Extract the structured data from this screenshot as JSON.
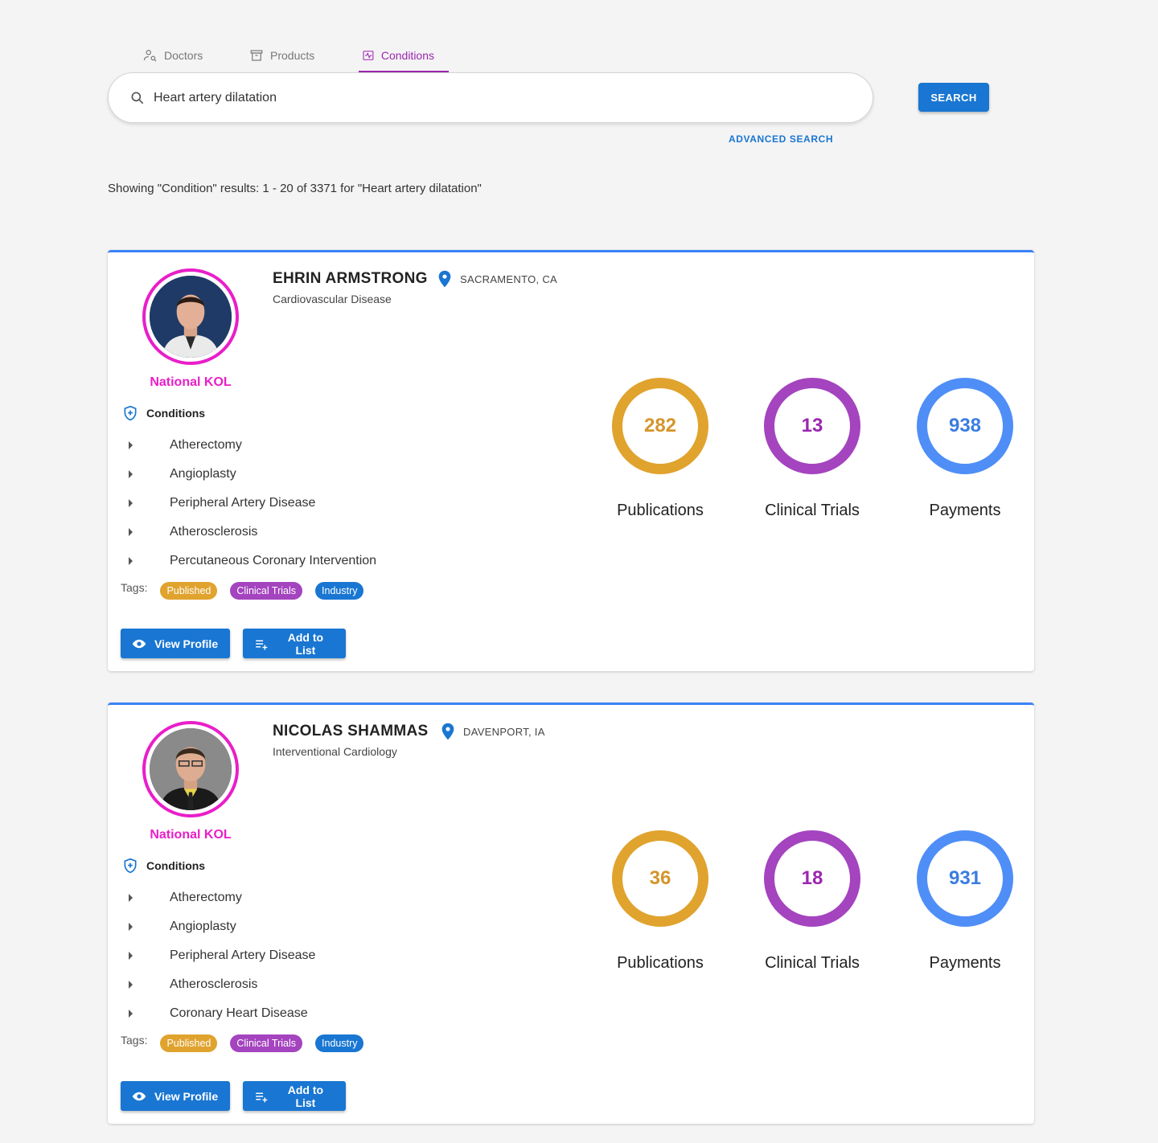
{
  "tabs": [
    {
      "label": "Doctors",
      "icon": "doctor-search-icon",
      "active": false
    },
    {
      "label": "Products",
      "icon": "archive-box-icon",
      "active": false
    },
    {
      "label": "Conditions",
      "icon": "condition-chart-icon",
      "active": true
    }
  ],
  "search": {
    "value": "Heart artery dilatation",
    "button_label": "SEARCH",
    "advanced_label": "ADVANCED SEARCH"
  },
  "results_summary": "Showing \"Condition\" results: 1 - 20 of 3371 for \"Heart artery dilatation\"",
  "colors": {
    "accent": "#9c27b0",
    "primary": "#1976d2",
    "kol": "#e91ec9",
    "publications": "#e0a32e",
    "clinical_trials": "#a444bf",
    "payments": "#4f8ef7"
  },
  "cards": [
    {
      "name": "EHRIN ARMSTRONG",
      "location": "SACRAMENTO, CA",
      "specialty": "Cardiovascular Disease",
      "badge": "National KOL",
      "conditions_label": "Conditions",
      "conditions": [
        "Atherectomy",
        "Angioplasty",
        "Peripheral Artery Disease",
        "Atherosclerosis",
        "Percutaneous Coronary Intervention"
      ],
      "tags_label": "Tags:",
      "tags": [
        "Published",
        "Clinical Trials",
        "Industry"
      ],
      "stats": [
        {
          "value": "282",
          "label": "Publications"
        },
        {
          "value": "13",
          "label": "Clinical Trials"
        },
        {
          "value": "938",
          "label": "Payments"
        }
      ],
      "view_label": "View Profile",
      "add_label": "Add to List"
    },
    {
      "name": "NICOLAS SHAMMAS",
      "location": "DAVENPORT, IA",
      "specialty": "Interventional Cardiology",
      "badge": "National KOL",
      "conditions_label": "Conditions",
      "conditions": [
        "Atherectomy",
        "Angioplasty",
        "Peripheral Artery Disease",
        "Atherosclerosis",
        "Coronary Heart Disease"
      ],
      "tags_label": "Tags:",
      "tags": [
        "Published",
        "Clinical Trials",
        "Industry"
      ],
      "stats": [
        {
          "value": "36",
          "label": "Publications"
        },
        {
          "value": "18",
          "label": "Clinical Trials"
        },
        {
          "value": "931",
          "label": "Payments"
        }
      ],
      "view_label": "View Profile",
      "add_label": "Add to List"
    }
  ]
}
